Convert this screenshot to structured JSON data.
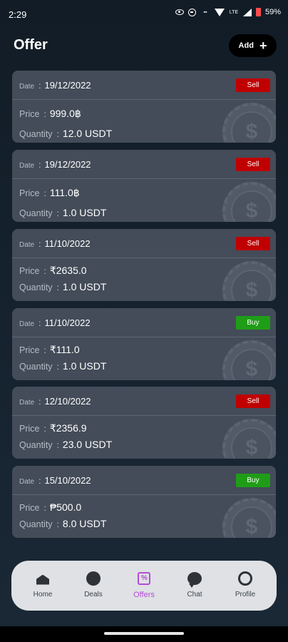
{
  "status": {
    "time": "2:29",
    "battery": "59%",
    "network": "LTE"
  },
  "header": {
    "title": "Offer",
    "add_label": "Add"
  },
  "labels": {
    "date": "Date",
    "price": "Price",
    "quantity": "Quantity",
    "separator": ":"
  },
  "colors": {
    "sell": "#c00000",
    "buy": "#1f9d17",
    "active_nav": "#b44cd8"
  },
  "offers": [
    {
      "date": "19/12/2022",
      "type": "Sell",
      "price": "999.0฿",
      "quantity": "12.0 USDT"
    },
    {
      "date": "19/12/2022",
      "type": "Sell",
      "price": "111.0฿",
      "quantity": "1.0 USDT"
    },
    {
      "date": "11/10/2022",
      "type": "Sell",
      "price": "₹2635.0",
      "quantity": "1.0 USDT"
    },
    {
      "date": "11/10/2022",
      "type": "Buy",
      "price": "₹111.0",
      "quantity": "1.0 USDT"
    },
    {
      "date": "12/10/2022",
      "type": "Sell",
      "price": "₹2356.9",
      "quantity": "23.0 USDT"
    },
    {
      "date": "15/10/2022",
      "type": "Buy",
      "price": "₱500.0",
      "quantity": "8.0 USDT"
    }
  ],
  "nav": {
    "items": [
      {
        "label": "Home",
        "icon": "home-icon"
      },
      {
        "label": "Deals",
        "icon": "deals-icon"
      },
      {
        "label": "Offers",
        "icon": "offers-icon",
        "active": true
      },
      {
        "label": "Chat",
        "icon": "chat-icon"
      },
      {
        "label": "Profile",
        "icon": "profile-icon"
      }
    ]
  }
}
